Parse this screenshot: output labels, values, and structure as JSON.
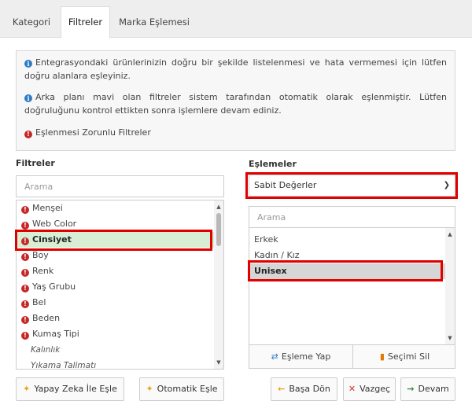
{
  "tabs": [
    {
      "label": "Kategori"
    },
    {
      "label": "Filtreler"
    },
    {
      "label": "Marka Eşlemesi"
    }
  ],
  "info": {
    "line1": "Entegrasyondaki ürünlerinizin doğru bir şekilde listelenmesi ve hata vermemesi için lütfen doğru alanlara eşleyiniz.",
    "line2": "Arka planı mavi olan filtreler sistem tarafından otomatik olarak eşlenmiştir. Lütfen doğruluğunu kontrol ettikten sonra işlemlere devam ediniz.",
    "line3": "Eşlenmesi Zorunlu Filtreler"
  },
  "filters": {
    "label": "Filtreler",
    "search_placeholder": "Arama",
    "items": [
      {
        "label": "Menşei",
        "required": true
      },
      {
        "label": "Web Color",
        "required": true
      },
      {
        "label": "Cinsiyet",
        "required": true,
        "selected": true
      },
      {
        "label": "Boy",
        "required": true
      },
      {
        "label": "Renk",
        "required": true
      },
      {
        "label": "Yaş Grubu",
        "required": true
      },
      {
        "label": "Bel",
        "required": true
      },
      {
        "label": "Beden",
        "required": true
      },
      {
        "label": "Kumaş Tipi",
        "required": true
      },
      {
        "label": "Kalınlık",
        "required": false
      },
      {
        "label": "Yıkama Talimatı",
        "required": false
      }
    ]
  },
  "mappings": {
    "label": "Eşlemeler",
    "select_value": "Sabit Değerler",
    "search_placeholder": "Arama",
    "items": [
      {
        "label": "Erkek"
      },
      {
        "label": "Kadın / Kız"
      },
      {
        "label": "Unisex",
        "selected": true
      }
    ],
    "map_button": "Eşleme Yap",
    "clear_button": "Seçimi Sil"
  },
  "buttons": {
    "ai_match": "Yapay Zeka İle Eşle",
    "auto_match": "Otomatik Eşle",
    "back": "Başa Dön",
    "cancel": "Vazgeç",
    "continue": "Devam"
  },
  "colors": {
    "selected_filter_bg": "#d8efd5",
    "selected_mapping_bg": "#d6d6d6",
    "required_icon": "#c62828",
    "info_icon": "#2f7bc4",
    "highlight_frame": "#e00000",
    "back_icon": "#e8a317",
    "cancel_icon": "#d32f2f",
    "continue_icon": "#2e8b3e",
    "map_icon": "#2f7bc4",
    "clear_icon": "#e07b00"
  }
}
